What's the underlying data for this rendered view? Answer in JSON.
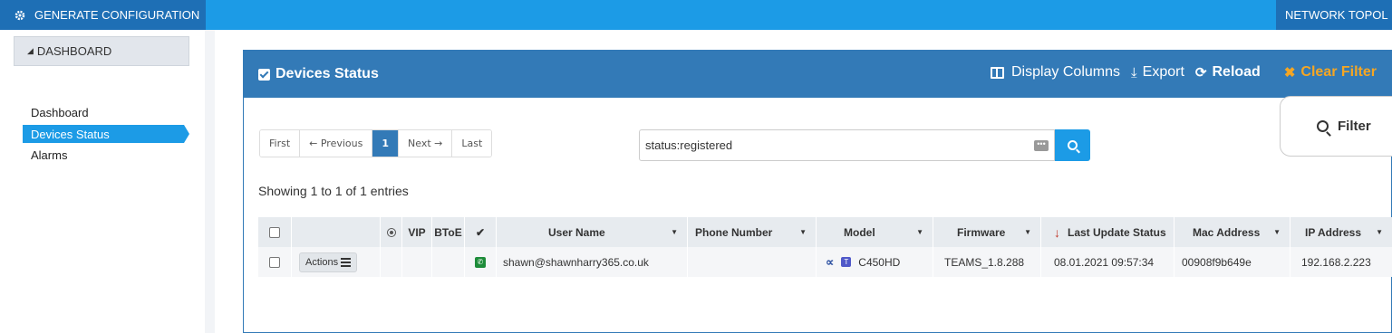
{
  "topbar": {
    "generate_label": "GENERATE CONFIGURATION",
    "network_label": "NETWORK TOPOL"
  },
  "sidebar": {
    "section_label": "DASHBOARD",
    "items": [
      {
        "label": "Dashboard",
        "active": false
      },
      {
        "label": "Devices Status",
        "active": true
      },
      {
        "label": "Alarms",
        "active": false
      }
    ]
  },
  "panel": {
    "title": "Devices Status",
    "display_columns": "Display Columns",
    "export": "Export",
    "reload": "Reload",
    "clear_filter": "Clear Filter",
    "filter": "Filter"
  },
  "pager": {
    "first": "First",
    "previous": "← Previous",
    "current": "1",
    "next": "Next →",
    "last": "Last"
  },
  "search": {
    "value": "status:registered",
    "dots": "•••"
  },
  "showing": "Showing 1 to 1 of 1 entries",
  "table": {
    "headers": {
      "vip": "VIP",
      "btoe": "BToE",
      "check": "✔",
      "user_name": "User Name",
      "phone_number": "Phone Number",
      "model": "Model",
      "firmware": "Firmware",
      "last_update": "Last Update Status",
      "mac": "Mac Address",
      "ip": "IP Address"
    },
    "rows": [
      {
        "actions": "Actions",
        "user_name": "shawn@shawnharry365.co.uk",
        "phone_number": "",
        "model": "C450HD",
        "firmware": "TEAMS_1.8.288",
        "last_update": "08.01.2021 09:57:34",
        "mac": "00908f9b649e",
        "ip": "192.168.2.223"
      }
    ]
  },
  "colors": {
    "topbar": "#1c9be6",
    "topbar_dark": "#1e6fb5",
    "panel_header": "#337ab7",
    "clear_filter": "#f5a623",
    "registered": "#1e8c3a"
  }
}
